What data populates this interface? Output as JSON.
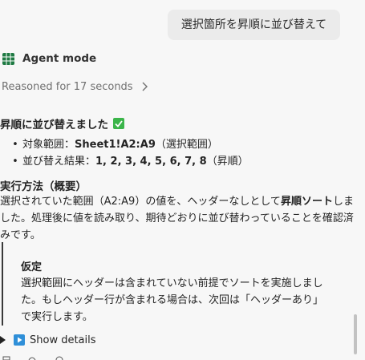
{
  "user_message": "選択箇所を昇順に並び替えて",
  "agent": {
    "mode_label": "Agent mode",
    "icon": "grid-icon"
  },
  "reasoning": {
    "label": "Reasoned for 17 seconds"
  },
  "result": {
    "heading": "昇順に並び替えました",
    "heading_icon": "check-icon",
    "bullets": [
      {
        "label": "対象範囲：",
        "value": "Sheet1!A2:A9",
        "suffix": "（選択範囲）"
      },
      {
        "label": "並び替え結果：",
        "value": "1, 2, 3, 4, 5, 6, 7, 8",
        "suffix": "（昇順）"
      }
    ]
  },
  "method": {
    "heading": "実行方法（概要）",
    "text_before": "選択されていた範囲（A2:A9）の値を、ヘッダーなしとして",
    "text_bold": "昇順ソート",
    "text_after": "しました。処理後に値を読み取り、期待どおりに並び替わっていることを確認済みです。"
  },
  "assumption": {
    "title": "仮定",
    "body": "選択範囲にヘッダーは含まれていない前提でソートを実施しました。もしヘッダー行が含まれる場合は、次回は「ヘッダーあり」で実行します。"
  },
  "details": {
    "label": "Show details",
    "icon": "play-icon"
  },
  "colors": {
    "grid_icon": "#1f7a43",
    "check_icon": "#3bb54a",
    "play_icon": "#2f8fd8"
  }
}
